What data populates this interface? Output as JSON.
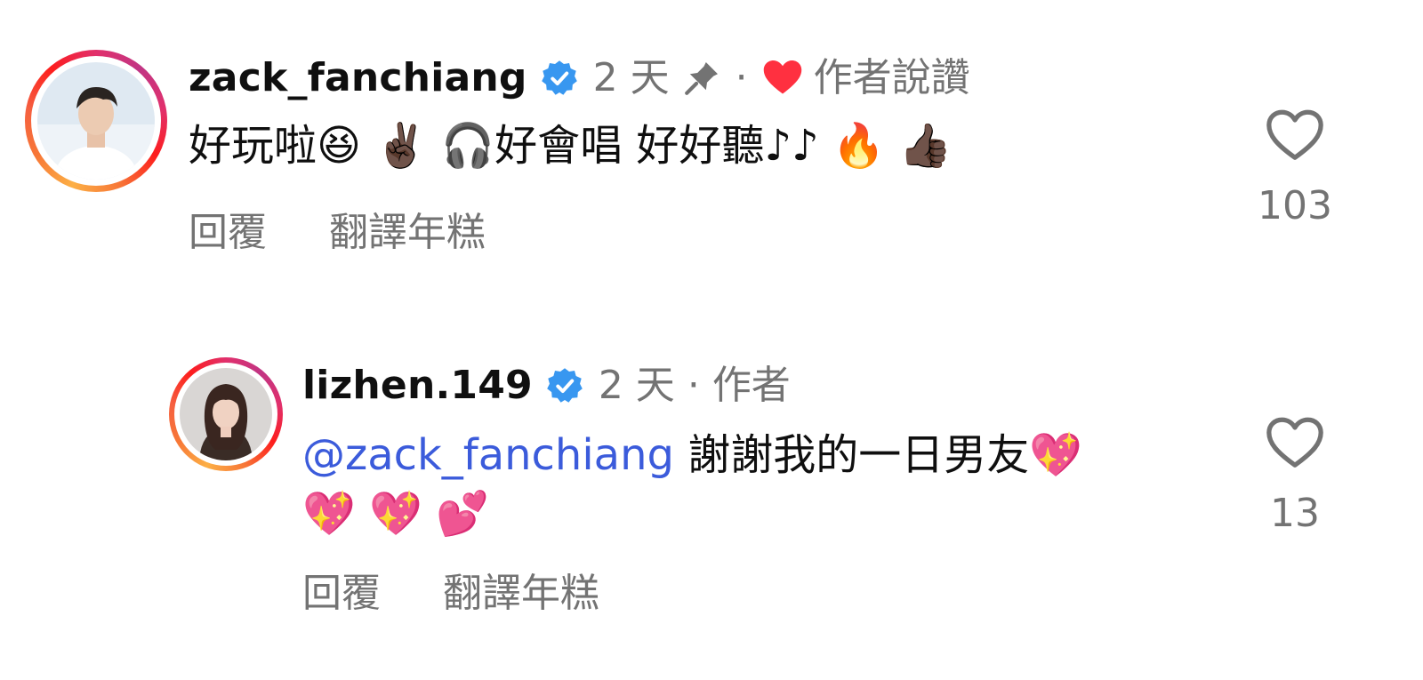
{
  "comments": [
    {
      "username": "zack_fanchiang",
      "time": "2 天",
      "author_liked_label": "作者說讚",
      "text": "好玩啦😆 ✌🏿 🎧好會唱 好好聽♪♪ 🔥 👍🏿",
      "reply_label": "回覆",
      "translate_label": "翻譯年糕",
      "like_count": "103",
      "pinned": true,
      "verified": true
    },
    {
      "username": "lizhen.149",
      "time": "2 天",
      "author_label": "作者",
      "mention": "@zack_fanchiang",
      "text_line1": " 謝謝我的一日男友💖",
      "text_line2": "💖 💖 💕",
      "reply_label": "回覆",
      "translate_label": "翻譯年糕",
      "like_count": "13",
      "verified": true
    }
  ],
  "colors": {
    "verified_blue": "#3897f0",
    "heart_red": "#ff3040",
    "mention_blue": "#3b5bdb",
    "meta_gray": "#737373"
  },
  "icons": [
    "verified-badge-icon",
    "pin-icon",
    "heart-filled-icon",
    "heart-outline-icon"
  ]
}
